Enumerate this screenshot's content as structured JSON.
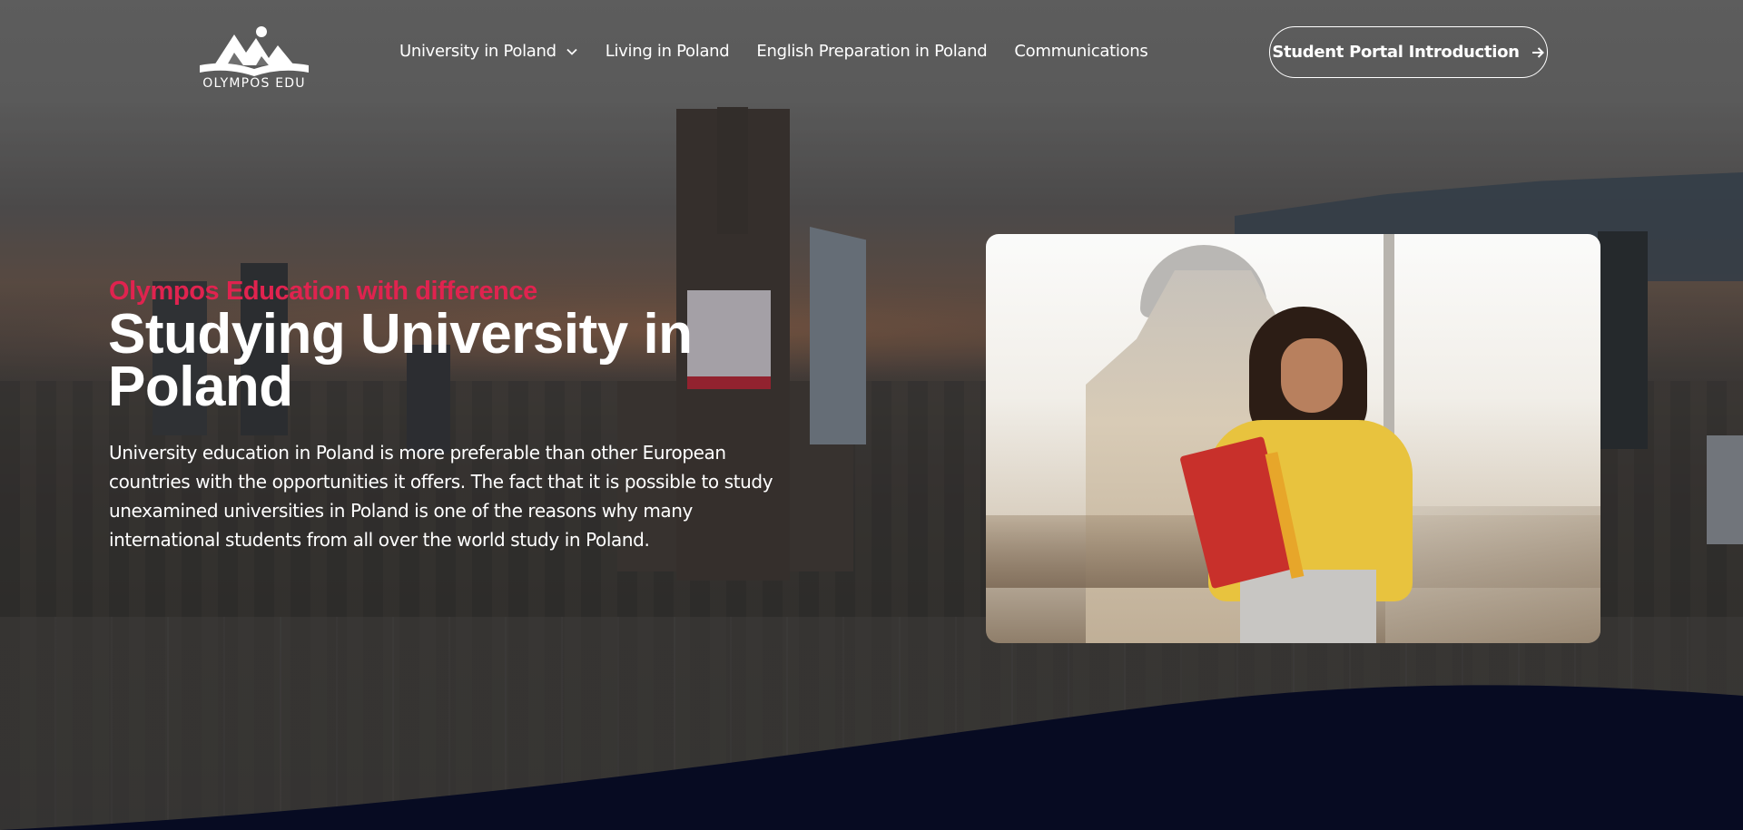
{
  "brand": {
    "name": "OLYMPOS EDU",
    "icon": "open-book-mountains-logo"
  },
  "nav": {
    "items": [
      {
        "label": "University in Poland",
        "has_dropdown": true,
        "icon": "chevron-down-icon"
      },
      {
        "label": "Living in Poland"
      },
      {
        "label": "English Preparation in Poland"
      },
      {
        "label": "Communications"
      }
    ],
    "cta": {
      "label": "Student Portal Introduction",
      "icon": "arrow-right-icon"
    }
  },
  "hero": {
    "tagline": "Olympos Education with difference",
    "title": "Studying University in Poland",
    "description": "University education in Poland is more preferable than other European countries with the opportunities it offers. The fact that it is possible to study unexamined universities in Poland is one of the reasons why many international students from all over the world study in Poland."
  },
  "colors": {
    "accent": "#e0234f",
    "text": "#ffffff",
    "wave": "#070b22"
  }
}
